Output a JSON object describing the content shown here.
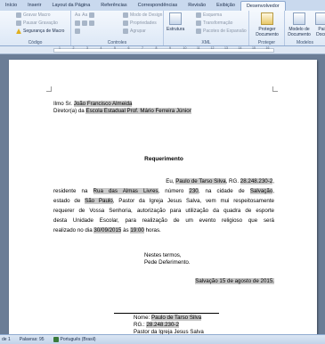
{
  "ribbon": {
    "tabs": [
      "Início",
      "Inserir",
      "Layout da Página",
      "Referências",
      "Correspondências",
      "Revisão",
      "Exibição",
      "Desenvolvedor"
    ],
    "active_tab": "Desenvolvedor",
    "code_group": {
      "label": "Código",
      "record_macro": "Gravar Macro",
      "pause_recording": "Pausar Gravação",
      "macro_security": "Segurança de Macro"
    },
    "controls_group": {
      "label": "Controles",
      "design_mode": "Modo de Design",
      "properties": "Propriedades",
      "group": "Agrupar"
    },
    "xml_group": {
      "label": "XML",
      "structure": "Estrutura",
      "schema": "Esquema",
      "transformation": "Transformação",
      "expansion_packs": "Pacotes de Expansão"
    },
    "protect_group": {
      "label": "Proteger",
      "protect_document": "Proteger Documento"
    },
    "templates_group": {
      "label": "Modelos",
      "document_template": "Modelo de Documento"
    },
    "cut_button": "Pai Docu"
  },
  "document": {
    "recipient_prefix": "Ilmo Sr. ",
    "recipient_name": "João Francisco Almeida",
    "recipient_title_prefix": "Diretor(a) da ",
    "school_name": "Escola Estadual Prof. Mário Ferreira Júnior",
    "title": "Requerimento",
    "body": {
      "l1_prefix": "Eu, ",
      "requester_name": "Paulo de Tarso Silva",
      "l1_mid": ", RG.",
      "rg_number": "28.248.230-2",
      "l1_end": ",",
      "l2_a": "residente na ",
      "street": "Rua das Almas Livres",
      "l2_b": ", número ",
      "house_number": "230",
      "l2_c": ", na cidade de ",
      "city": "Salvação",
      "l2_d": ",",
      "l3_a": "estado de ",
      "state": "São Paulo",
      "l3_b": ", Pastor da Igreja Jesus Salva, vem mui respeitosamente",
      "l4": "requerer de Vossa Senhoria, autorização para utilização da quadra de esporte",
      "l5": "desta Unidade Escolar, para realização de um evento religioso que será",
      "l6_a": "realizado no dia ",
      "event_date": "30/09/2015",
      "l6_b": " às ",
      "event_time": "19:00",
      "l6_c": " horas."
    },
    "closing_1": "Nestes termos,",
    "closing_2": "Pede Deferimento.",
    "place_date": "Salvação 15 de agosto de 2015.",
    "signature": {
      "name_label": "Nome: ",
      "name_value": "Paulo de Tarso Silva",
      "rg_label": "RG.: ",
      "rg_value": "28.248.230-2",
      "role": "Pastor da Igreja Jesus Salva"
    }
  },
  "status_bar": {
    "page": "de 1",
    "words": "Palavras: 95",
    "language": "Português (Brasil)"
  }
}
